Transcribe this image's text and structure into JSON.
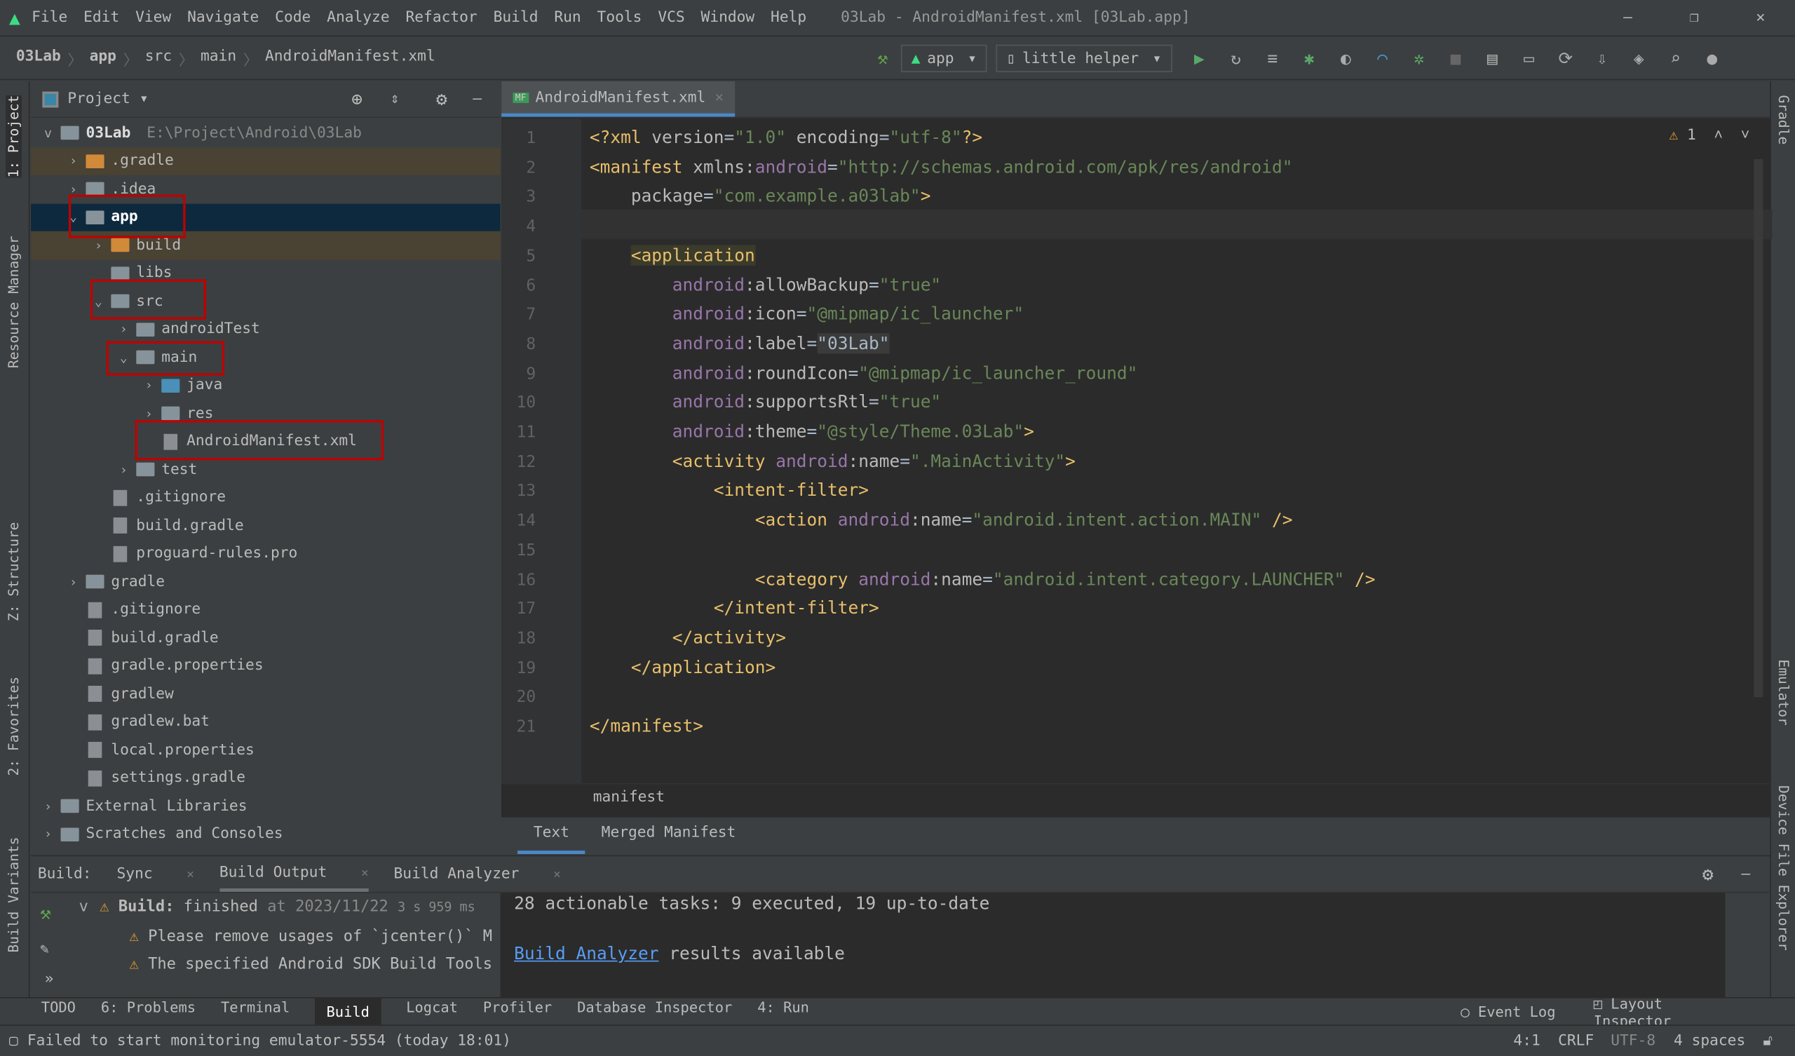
{
  "menu": [
    "File",
    "Edit",
    "View",
    "Navigate",
    "Code",
    "Analyze",
    "Refactor",
    "Build",
    "Run",
    "Tools",
    "VCS",
    "Window",
    "Help"
  ],
  "window_title": "03Lab - AndroidManifest.xml [03Lab.app]",
  "breadcrumb": [
    "03Lab",
    "app",
    "src",
    "main",
    "AndroidManifest.xml"
  ],
  "toolbar": {
    "config": "app",
    "device": "little helper"
  },
  "left_strip": [
    "1: Project",
    "Resource Manager",
    "Z: Structure",
    "2: Favorites",
    "Build Variants"
  ],
  "right_strip": [
    "Gradle",
    "Emulator",
    "Device File Explorer"
  ],
  "project": {
    "title": "Project",
    "root": "03Lab",
    "root_path": "E:\\Project\\Android\\03Lab",
    "items": [
      {
        "label": ".gradle",
        "level": 1,
        "arrow": ">",
        "type": "orange"
      },
      {
        "label": ".idea",
        "level": 1,
        "arrow": ">",
        "type": "folder"
      },
      {
        "label": "app",
        "level": 1,
        "arrow": "v",
        "type": "module",
        "selected": true
      },
      {
        "label": "build",
        "level": 2,
        "arrow": ">",
        "type": "orange"
      },
      {
        "label": "libs",
        "level": 2,
        "arrow": "",
        "type": "folder"
      },
      {
        "label": "src",
        "level": 2,
        "arrow": "v",
        "type": "folder"
      },
      {
        "label": "androidTest",
        "level": 3,
        "arrow": ">",
        "type": "folder"
      },
      {
        "label": "main",
        "level": 3,
        "arrow": "v",
        "type": "folder"
      },
      {
        "label": "java",
        "level": 4,
        "arrow": ">",
        "type": "blue"
      },
      {
        "label": "res",
        "level": 4,
        "arrow": ">",
        "type": "folder"
      },
      {
        "label": "AndroidManifest.xml",
        "level": 4,
        "arrow": "",
        "type": "file"
      },
      {
        "label": "test",
        "level": 3,
        "arrow": ">",
        "type": "folder"
      },
      {
        "label": ".gitignore",
        "level": 2,
        "arrow": "",
        "type": "file"
      },
      {
        "label": "build.gradle",
        "level": 2,
        "arrow": "",
        "type": "file"
      },
      {
        "label": "proguard-rules.pro",
        "level": 2,
        "arrow": "",
        "type": "file"
      },
      {
        "label": "gradle",
        "level": 1,
        "arrow": ">",
        "type": "folder"
      },
      {
        "label": ".gitignore",
        "level": 1,
        "arrow": "",
        "type": "file"
      },
      {
        "label": "build.gradle",
        "level": 1,
        "arrow": "",
        "type": "file"
      },
      {
        "label": "gradle.properties",
        "level": 1,
        "arrow": "",
        "type": "file"
      },
      {
        "label": "gradlew",
        "level": 1,
        "arrow": "",
        "type": "file"
      },
      {
        "label": "gradlew.bat",
        "level": 1,
        "arrow": "",
        "type": "file"
      },
      {
        "label": "local.properties",
        "level": 1,
        "arrow": "",
        "type": "file"
      },
      {
        "label": "settings.gradle",
        "level": 1,
        "arrow": "",
        "type": "file"
      },
      {
        "label": "External Libraries",
        "level": 0,
        "arrow": ">",
        "type": "lib"
      },
      {
        "label": "Scratches and Consoles",
        "level": 0,
        "arrow": ">",
        "type": "lib"
      }
    ]
  },
  "editor": {
    "tab": "AndroidManifest.xml",
    "warnings": "1",
    "breadcrumb": "manifest",
    "subtabs": [
      "Text",
      "Merged Manifest"
    ],
    "lines": [
      [
        [
          "tag",
          "<?xml "
        ],
        [
          "attr",
          "version"
        ],
        [
          "pl",
          "="
        ],
        [
          "str",
          "\"1.0\""
        ],
        [
          "attr",
          " encoding"
        ],
        [
          "pl",
          "="
        ],
        [
          "str",
          "\"utf-8\""
        ],
        [
          "tag",
          "?>"
        ]
      ],
      [
        [
          "tag",
          "<manifest "
        ],
        [
          "attr",
          "xmlns:"
        ],
        [
          "ns",
          "android"
        ],
        [
          "pl",
          "="
        ],
        [
          "str",
          "\"http://schemas.android.com/apk/res/android\""
        ]
      ],
      [
        [
          "pl",
          "    "
        ],
        [
          "attr",
          "package"
        ],
        [
          "pl",
          "="
        ],
        [
          "str",
          "\"com.example.a03lab\""
        ],
        [
          "tag",
          ">"
        ]
      ],
      [],
      [
        [
          "pl",
          "    "
        ],
        [
          "app",
          "<application"
        ]
      ],
      [
        [
          "pl",
          "        "
        ],
        [
          "ns",
          "android"
        ],
        [
          "attr",
          ":allowBackup"
        ],
        [
          "pl",
          "="
        ],
        [
          "str",
          "\"true\""
        ]
      ],
      [
        [
          "pl",
          "        "
        ],
        [
          "ns",
          "android"
        ],
        [
          "attr",
          ":icon"
        ],
        [
          "pl",
          "="
        ],
        [
          "str",
          "\"@mipmap/ic_launcher\""
        ]
      ],
      [
        [
          "pl",
          "        "
        ],
        [
          "ns",
          "android"
        ],
        [
          "attr",
          ":label"
        ],
        [
          "pl",
          "="
        ],
        [
          "hl",
          "\"03Lab\""
        ]
      ],
      [
        [
          "pl",
          "        "
        ],
        [
          "ns",
          "android"
        ],
        [
          "attr",
          ":roundIcon"
        ],
        [
          "pl",
          "="
        ],
        [
          "str",
          "\"@mipmap/ic_launcher_round\""
        ]
      ],
      [
        [
          "pl",
          "        "
        ],
        [
          "ns",
          "android"
        ],
        [
          "attr",
          ":supportsRtl"
        ],
        [
          "pl",
          "="
        ],
        [
          "str",
          "\"true\""
        ]
      ],
      [
        [
          "pl",
          "        "
        ],
        [
          "ns",
          "android"
        ],
        [
          "attr",
          ":theme"
        ],
        [
          "pl",
          "="
        ],
        [
          "str",
          "\"@style/Theme.03Lab\""
        ],
        [
          "tag",
          ">"
        ]
      ],
      [
        [
          "pl",
          "        "
        ],
        [
          "tag",
          "<activity "
        ],
        [
          "ns",
          "android"
        ],
        [
          "attr",
          ":name"
        ],
        [
          "pl",
          "="
        ],
        [
          "str",
          "\".MainActivity\""
        ],
        [
          "tag",
          ">"
        ]
      ],
      [
        [
          "pl",
          "            "
        ],
        [
          "tag",
          "<intent-filter>"
        ]
      ],
      [
        [
          "pl",
          "                "
        ],
        [
          "tag",
          "<action "
        ],
        [
          "ns",
          "android"
        ],
        [
          "attr",
          ":name"
        ],
        [
          "pl",
          "="
        ],
        [
          "str",
          "\"android.intent.action.MAIN\""
        ],
        [
          "tag",
          " />"
        ]
      ],
      [],
      [
        [
          "pl",
          "                "
        ],
        [
          "tag",
          "<category "
        ],
        [
          "ns",
          "android"
        ],
        [
          "attr",
          ":name"
        ],
        [
          "pl",
          "="
        ],
        [
          "str",
          "\"android.intent.category.LAUNCHER\""
        ],
        [
          "tag",
          " />"
        ]
      ],
      [
        [
          "pl",
          "            "
        ],
        [
          "tag",
          "</intent-filter>"
        ]
      ],
      [
        [
          "pl",
          "        "
        ],
        [
          "tag",
          "</activity>"
        ]
      ],
      [
        [
          "pl",
          "    "
        ],
        [
          "tag",
          "</application>"
        ]
      ],
      [],
      [
        [
          "tag",
          "</manifest>"
        ]
      ]
    ]
  },
  "build": {
    "label": "Build:",
    "tabs": [
      "Sync",
      "Build Output",
      "Build Analyzer"
    ],
    "tree": {
      "status_label": "Build:",
      "status": "finished",
      "time": "at 2023/11/22",
      "duration": "3 s 959 ms",
      "warnings": [
        "Please remove usages of `jcenter()` M",
        "The specified Android SDK Build Tools"
      ]
    },
    "output": [
      "28 actionable tasks: 9 executed, 19 up-to-date"
    ],
    "link": "Build Analyzer",
    "link_suffix": " results available"
  },
  "bottom_tabs": [
    "TODO",
    "6: Problems",
    "Terminal",
    "Build",
    "Logcat",
    "Profiler",
    "Database Inspector",
    "4: Run"
  ],
  "bottom_right": [
    "Event Log",
    "Layout Inspector"
  ],
  "status": {
    "message": "Failed to start monitoring emulator-5554 (today 18:01)",
    "position": "4:1",
    "line_sep": "CRLF",
    "encoding": "UTF-8",
    "indent": "4 spaces"
  },
  "colors": {
    "accent": "#4a88c7",
    "tag": "#e8bf6a",
    "string": "#6a8759",
    "namespace": "#9876aa",
    "selection": "#0d293e",
    "highlight_box": "#c00000"
  }
}
